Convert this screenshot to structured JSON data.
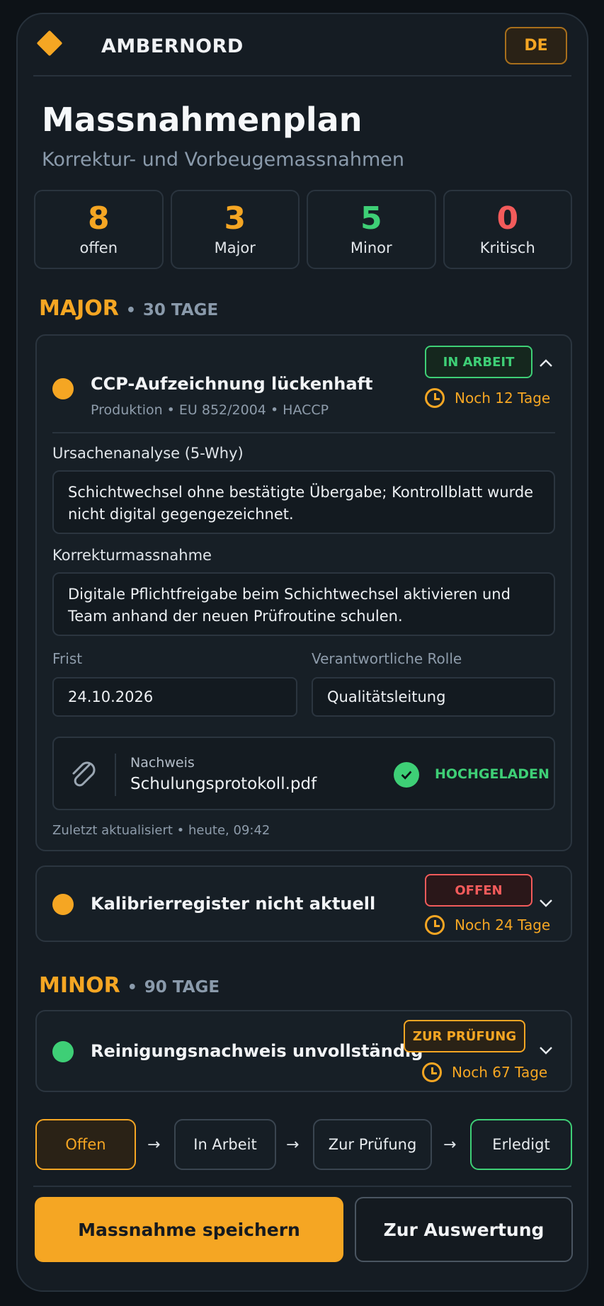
{
  "brand": {
    "name": "AMBERNORD",
    "language": "DE"
  },
  "page": {
    "title": "Massnahmenplan",
    "subtitle": "Korrektur- und Vorbeugemassnahmen"
  },
  "stats": [
    {
      "value": "8",
      "label": "offen",
      "color": "#f5a623"
    },
    {
      "value": "3",
      "label": "Major",
      "color": "#f5a623"
    },
    {
      "value": "5",
      "label": "Minor",
      "color": "#3ecf76"
    },
    {
      "value": "0",
      "label": "Kritisch",
      "color": "#f25b5b"
    }
  ],
  "sections": {
    "major": {
      "label": "MAJOR",
      "separator": "•",
      "days": "30 TAGE"
    },
    "minor": {
      "label": "MINOR",
      "separator": "•",
      "days": "90 TAGE"
    }
  },
  "findings": [
    {
      "title": "CCP-Aufzeichnung lückenhaft",
      "meta": "Produktion  •  EU 852/2004  •  HACCP",
      "status": "IN ARBEIT",
      "status_color": "#3ecf76",
      "due": "Noch 12 Tage",
      "severity_color": "#f5a623",
      "expanded": true,
      "root_cause_label": "Ursachenanalyse (5-Why)",
      "root_cause": "Schichtwechsel ohne bestätigte Übergabe; Kontrollblatt wurde nicht digital gegengezeichnet.",
      "correction_label": "Korrekturmassnahme",
      "correction": "Digitale Pflichtfreigabe beim Schichtwechsel aktivieren und Team anhand der neuen Prüfroutine schulen.",
      "deadline_label": "Frist",
      "deadline": "24.10.2026",
      "role_label": "Verantwortliche Rolle",
      "role": "Qualitätsleitung",
      "evidence_label": "Nachweis",
      "evidence_file": "Schulungsprotokoll.pdf",
      "evidence_status": "HOCHGELADEN",
      "updated": "Zuletzt aktualisiert  •  heute, 09:42"
    },
    {
      "title": "Kalibrierregister nicht aktuell",
      "status": "OFFEN",
      "status_color": "#f25b5b",
      "due": "Noch 24 Tage",
      "severity_color": "#f5a623"
    },
    {
      "title": "Reinigungsnachweis unvollständig",
      "status": "ZUR PRÜFUNG",
      "status_color": "#f5a623",
      "due": "Noch 67 Tage",
      "severity_color": "#3ecf76"
    }
  ],
  "workflow": {
    "steps": [
      "Offen",
      "In Arbeit",
      "Zur Prüfung",
      "Erledigt"
    ],
    "arrow": "→"
  },
  "actions": {
    "save": "Massnahme speichern",
    "report": "Zur Auswertung"
  },
  "colors": {
    "accent": "#f5a623",
    "success": "#3ecf76",
    "danger": "#f25b5b"
  }
}
